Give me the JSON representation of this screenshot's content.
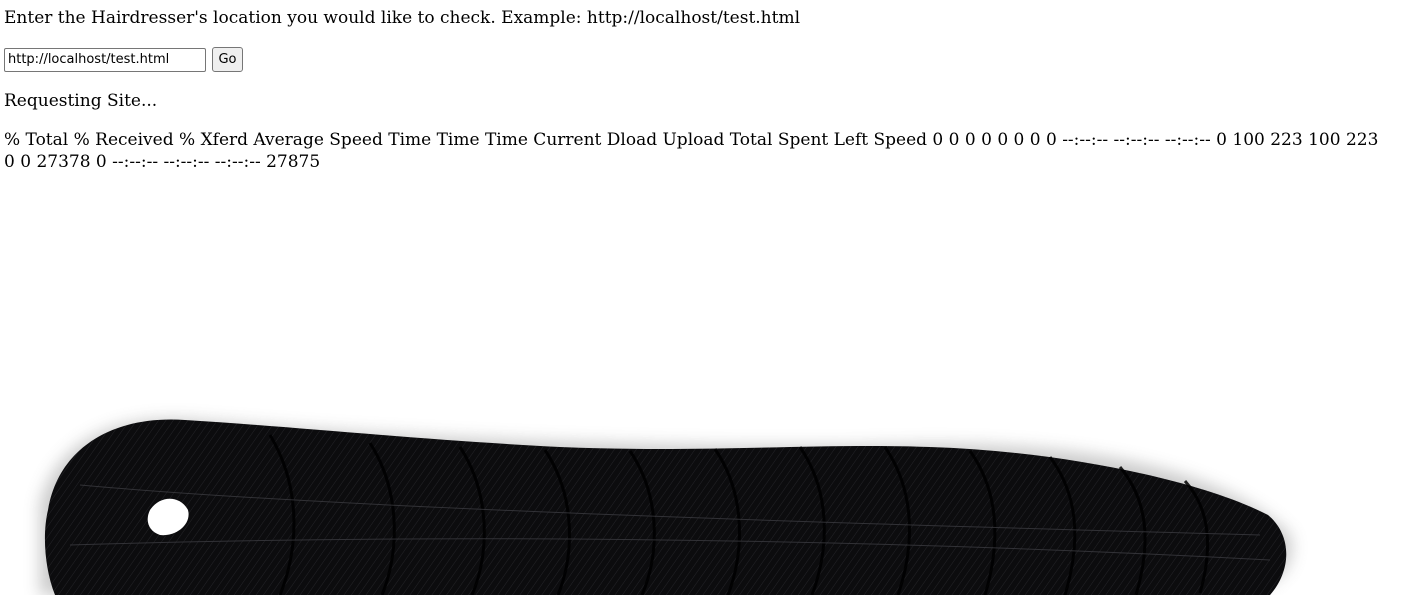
{
  "prompt": "Enter the Hairdresser's location you would like to check. Example: http://localhost/test.html",
  "form": {
    "url_value": "http://localhost/test.html",
    "go_label": "Go"
  },
  "status": "Requesting Site...",
  "curl_output": "% Total % Received % Xferd Average Speed Time Time Time Current Dload Upload Total Spent Left Speed 0 0 0 0 0 0 0 0 --:--:-- --:--:-- --:--:-- 0 100 223 100 223 0 0 27378 0 --:--:-- --:--:-- --:--:-- 27875",
  "image": {
    "subject": "braided-black-hair-extension-icon",
    "color": "#0d0d0f"
  }
}
